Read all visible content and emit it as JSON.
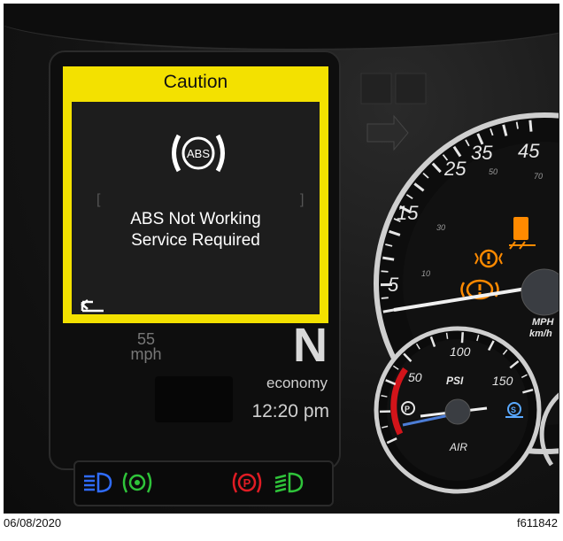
{
  "display": {
    "header": "Caution",
    "message_line1": "ABS Not Working",
    "message_line2": "Service Required",
    "abs_icon_text": "ABS",
    "speed_value": "55",
    "speed_unit": "mph",
    "gear": "N",
    "mode": "economy",
    "time": "12:20 pm"
  },
  "speedometer": {
    "ticks": [
      "5",
      "15",
      "25",
      "35",
      "45"
    ],
    "minor_ticks": [
      "10",
      "30",
      "50",
      "70"
    ],
    "unit_top": "MPH",
    "unit_bottom": "km/h"
  },
  "air_gauge": {
    "ticks": [
      "50",
      "100",
      "150"
    ],
    "unit": "PSI",
    "label": "AIR"
  },
  "footer": {
    "date": "06/08/2020",
    "figure_id": "f611842"
  },
  "colors": {
    "caution_yellow": "#f3e100",
    "indicator_blue": "#2f6cff",
    "indicator_green": "#2fc43a",
    "indicator_red": "#e01c24",
    "warning_amber": "#ff8a00",
    "gauge_red": "#d2141a"
  },
  "icons": [
    "abs-warning-icon",
    "back-arrow-icon",
    "headlight-icon",
    "brake-green-icon",
    "parking-brake-icon",
    "low-beam-icon",
    "engine-warning-icon",
    "tire-icon",
    "abs-amber-icon",
    "air-parking-icon",
    "air-service-icon"
  ]
}
